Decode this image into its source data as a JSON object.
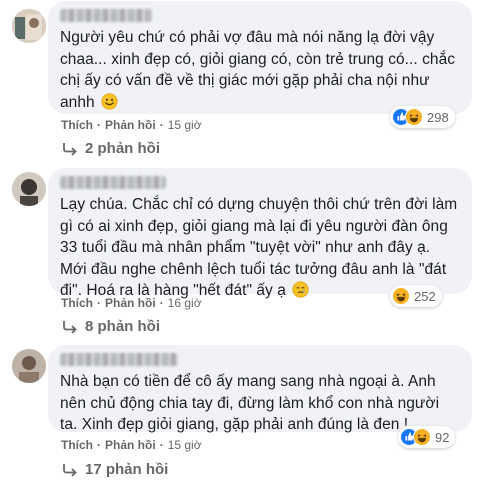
{
  "comments": [
    {
      "text": "Người yêu chứ có phải vợ đâu mà nói năng lạ đời vậy chaa... xinh đẹp có, giỏi giang có, còn trẻ trung có... chắc chị ấy có vấn đề về thị giác mới gặp phải cha nội như anhh",
      "reaction_count": "298",
      "action_like": "Thích",
      "action_reply": "Phản hồi",
      "time": "15 giờ",
      "replies_label": "2 phản hồi"
    },
    {
      "text": "Lạy chúa. Chắc chỉ có dựng chuyện thôi chứ trên đời làm gì có ai xinh đẹp, giỏi giang mà lại đi yêu người đàn ông 33 tuổi đầu mà nhân phẩm \"tuyệt vời\" như anh đây ạ. Mới đầu nghe chênh lệch tuổi tác tưởng đâu anh là \"đát đi\". Hoá ra là hàng \"hết đát\" ấy ạ",
      "reaction_count": "252",
      "action_like": "Thích",
      "action_reply": "Phản hồi",
      "time": "16 giờ",
      "replies_label": "8 phản hồi"
    },
    {
      "text": "Nhà bạn có tiền để cô ấy mang sang nhà ngoại à. Anh nên chủ động chia tay đi, đừng làm khổ con nhà người ta. Xinh đẹp giỏi giang, gặp phải anh đúng là đen !",
      "reaction_count": "92",
      "action_like": "Thích",
      "action_reply": "Phản hồi",
      "time": "15 giờ",
      "replies_label": "17 phản hồi"
    }
  ],
  "colors": {
    "like_blue": "#1877f2",
    "haha_yellow": "#f7b125",
    "bubble_bg": "#f0f2f5",
    "meta_gray": "#65676b"
  },
  "icons": [
    "like-icon",
    "haha-icon",
    "smile-emoji-icon",
    "crying-emoji-icon",
    "reply-arrow-icon"
  ]
}
